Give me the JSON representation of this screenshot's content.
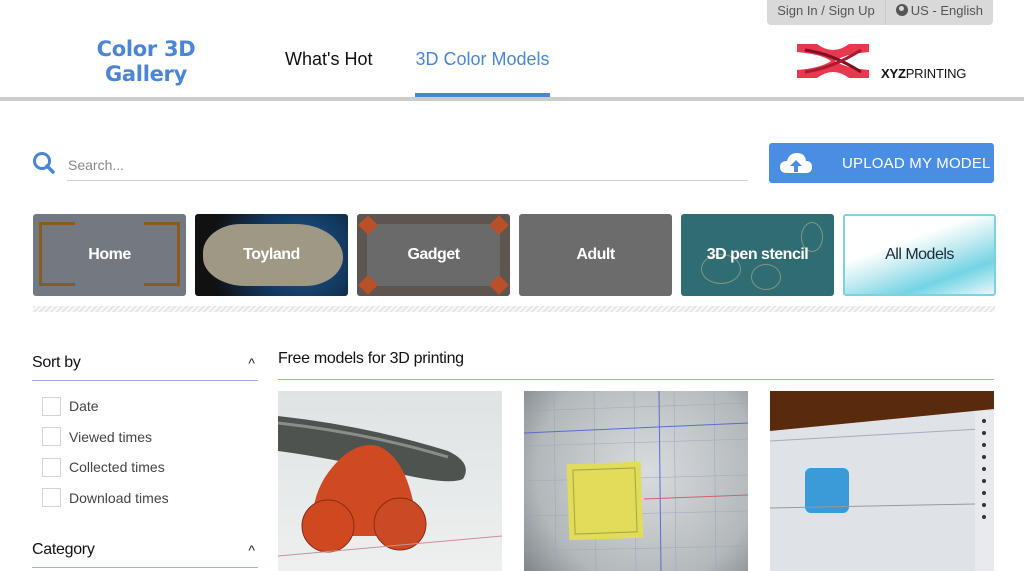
{
  "topbar": {
    "signin": "Sign In / Sign Up",
    "language": "US - English",
    "language_icon": "globe-icon"
  },
  "header": {
    "logo_line1": "Color 3D",
    "logo_line2": "Gallery",
    "nav": [
      {
        "label": "What's Hot",
        "active": false
      },
      {
        "label": "3D Color Models",
        "active": true
      }
    ],
    "brand_bold": "XYZ",
    "brand_rest": "PRINTING"
  },
  "search": {
    "placeholder": "Search...",
    "value": "",
    "icon": "search-icon"
  },
  "upload": {
    "label": "UPLOAD MY MODEL",
    "icon": "cloud-upload-icon"
  },
  "categories": [
    {
      "label": "Home"
    },
    {
      "label": "Toyland"
    },
    {
      "label": "Gadget"
    },
    {
      "label": "Adult"
    },
    {
      "label": "3D pen stencil"
    },
    {
      "label": "All Models",
      "selected": true
    }
  ],
  "sidebar": {
    "sort_title": "Sort by",
    "sort_options": [
      {
        "label": "Date",
        "checked": false
      },
      {
        "label": "Viewed times",
        "checked": false
      },
      {
        "label": "Collected times",
        "checked": false
      },
      {
        "label": "Download times",
        "checked": false
      }
    ],
    "category_title": "Category",
    "chevron": "^"
  },
  "main": {
    "title": "Free models for 3D printing",
    "cards": [
      {
        "alt": "orange car model in 3D editor"
      },
      {
        "alt": "yellow square on grid"
      },
      {
        "alt": "blue model on tablet screen"
      }
    ]
  },
  "colors": {
    "accent": "#4a86d4",
    "upload_button": "#4a8ee4",
    "brand_red": "#e8384f"
  }
}
